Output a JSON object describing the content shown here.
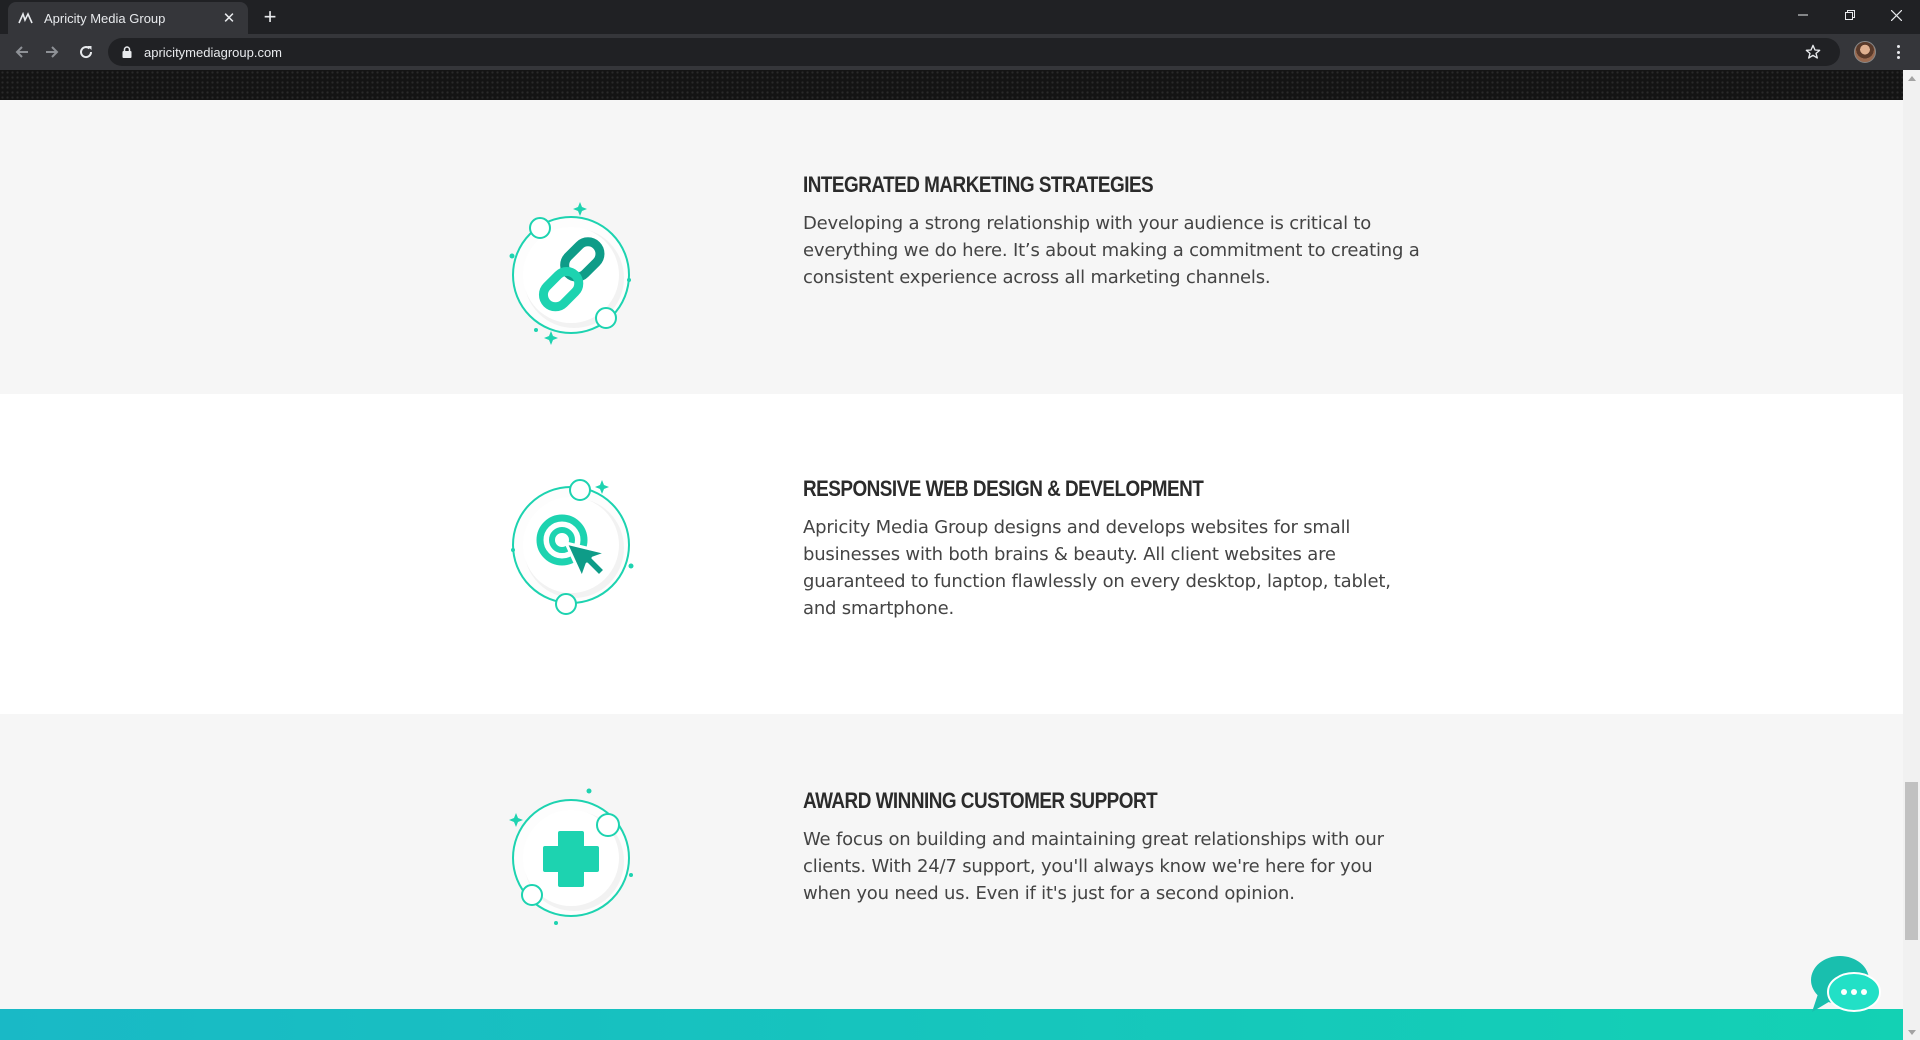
{
  "browser": {
    "tab_title": "Apricity Media Group",
    "url": "apricitymediagroup.com"
  },
  "features": [
    {
      "title": "INTEGRATED MARKETING STRATEGIES",
      "description": "Developing a strong relationship with your audience is critical to everything we do here. It’s about making a commitment to creating a consistent experience across all marketing channels.",
      "icon": "chain-link-icon"
    },
    {
      "title": "RESPONSIVE WEB DESIGN & DEVELOPMENT",
      "description": "Apricity Media Group designs and develops websites for small businesses with both brains & beauty. All client websites are guaranteed to function flawlessly on every desktop, laptop, tablet, and smartphone.",
      "icon": "cursor-click-icon"
    },
    {
      "title": "AWARD WINNING CUSTOMER SUPPORT",
      "description": "We focus on building and maintaining great relationships with our clients. With 24/7 support, you'll always know we're here for you when you need us. Even if it's just for a second opinion.",
      "icon": "medical-cross-icon"
    }
  ],
  "colors": {
    "accent_teal": "#1dd3b0",
    "icon_dark_teal": "#0e9c88",
    "footer_gradient_start": "#19b9c6",
    "footer_gradient_end": "#13d1b4"
  }
}
